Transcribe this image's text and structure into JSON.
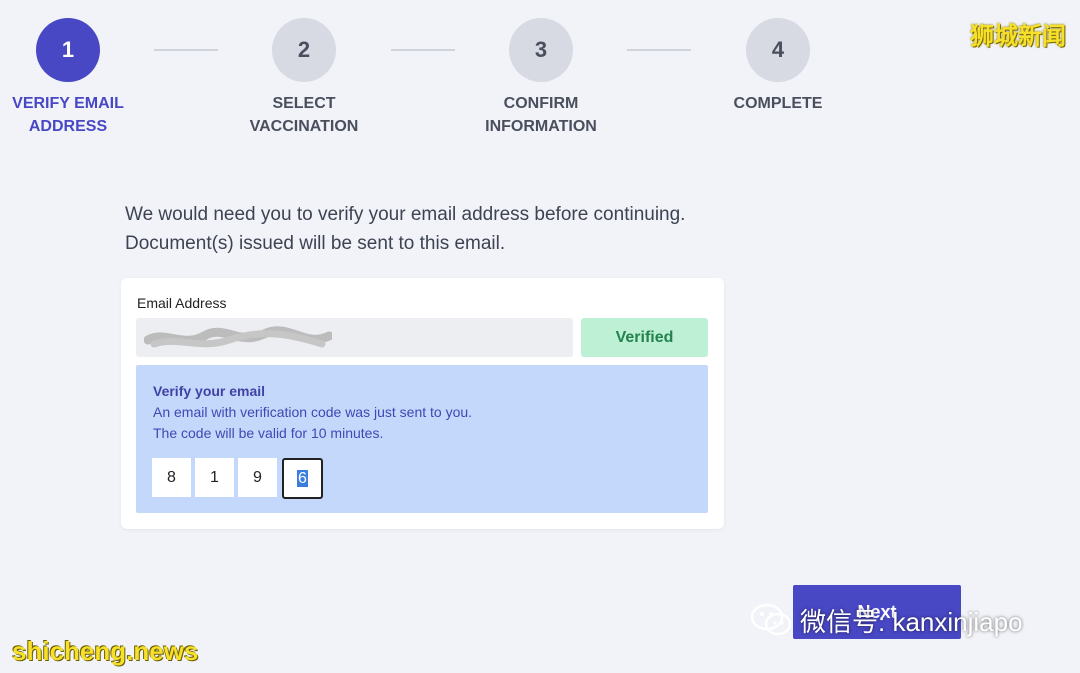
{
  "stepper": {
    "steps": [
      {
        "number": "1",
        "label": "VERIFY EMAIL\nADDRESS",
        "active": true
      },
      {
        "number": "2",
        "label": "SELECT\nVACCINATION",
        "active": false
      },
      {
        "number": "3",
        "label": "CONFIRM\nINFORMATION",
        "active": false
      },
      {
        "number": "4",
        "label": "COMPLETE",
        "active": false
      }
    ]
  },
  "intro": {
    "line1": "We would need you to verify your email address before continuing.",
    "line2": "Document(s) issued will be sent to this email."
  },
  "email_field": {
    "label": "Email Address",
    "status_button": "Verified"
  },
  "verification": {
    "title": "Verify your email",
    "line1": "An email with verification code was just sent to you.",
    "line2": "The code will be valid for 10 minutes.",
    "digits": [
      "8",
      "1",
      "9",
      "6"
    ]
  },
  "next_button": "Next",
  "watermarks": {
    "top_right": "狮城新闻",
    "bottom_left": "shicheng.news",
    "wechat": "微信号: kanxinjiapo"
  },
  "colors": {
    "primary": "#4847c4",
    "verified_bg": "#bdf0d4",
    "verified_text": "#23824d",
    "panel_bg": "#c4d8fb"
  }
}
